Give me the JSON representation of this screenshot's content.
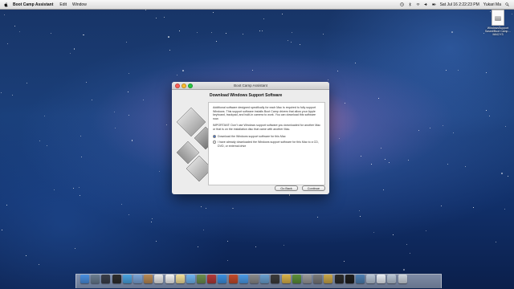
{
  "menubar": {
    "app_name": "Boot Camp Assistant",
    "menus": [
      "Edit",
      "Window"
    ],
    "clock": "Sat Jul 16  2:22:23 PM",
    "user": "Yukari Ma"
  },
  "desktop_icon": {
    "label": "WindowsSupport Saved/Boot Camp… MAC/Y3"
  },
  "window": {
    "title": "Boot Camp Assistant",
    "heading": "Download Windows Support Software",
    "body_p1": "Additional software designed specifically for each Mac is required to fully support Windows. This support software installs Boot Camp drivers that allow your Apple keyboard, trackpad, and built-in camera to work. You can download this software now.",
    "body_p2": "IMPORTANT: Don't use Windows support software you downloaded for another Mac or that is on the installation disc that came with another Mac.",
    "option_download": "Download the Windows support software for this Mac",
    "option_downloaded": "I have already downloaded the Windows support software for this Mac to a CD, DVD, or external drive",
    "selected_option": "download",
    "go_back_label": "Go Back",
    "continue_label": "Continue"
  },
  "dock": {
    "icons": [
      {
        "name": "finder-icon",
        "color": "#4a8fe0"
      },
      {
        "name": "launchpad-icon",
        "color": "#6a7d90"
      },
      {
        "name": "mission-control-icon",
        "color": "#3a3f4a"
      },
      {
        "name": "dashboard-icon",
        "color": "#2e2e2e"
      },
      {
        "name": "safari-icon",
        "color": "#4aa3e0"
      },
      {
        "name": "mail-icon",
        "color": "#7aa5d8"
      },
      {
        "name": "contacts-icon",
        "color": "#b88a56"
      },
      {
        "name": "calendar-icon",
        "color": "#e8e8e8"
      },
      {
        "name": "reminders-icon",
        "color": "#f2f2f2"
      },
      {
        "name": "notes-icon",
        "color": "#f3e09a"
      },
      {
        "name": "messages-icon",
        "color": "#6fb4f0"
      },
      {
        "name": "facetime-icon",
        "color": "#6b8e4e"
      },
      {
        "name": "photo-booth-icon",
        "color": "#b23a3a"
      },
      {
        "name": "itunes-icon",
        "color": "#3b8fe0"
      },
      {
        "name": "books-icon",
        "color": "#c44a2a"
      },
      {
        "name": "app-store-icon",
        "color": "#4b9be8"
      },
      {
        "name": "system-preferences-icon",
        "color": "#8a8a8a"
      },
      {
        "name": "preview-icon",
        "color": "#6aa0d0"
      },
      {
        "name": "console-icon",
        "color": "#3c3c3c"
      },
      {
        "name": "directory-icon",
        "color": "#d9b24a"
      },
      {
        "name": "network-utility-icon",
        "color": "#5c8f3a"
      },
      {
        "name": "disk-utility-icon",
        "color": "#9a9a9a"
      },
      {
        "name": "boot-camp-assistant-icon",
        "color": "#7a7a7a"
      },
      {
        "name": "keychain-icon",
        "color": "#c9a64a"
      },
      {
        "name": "activity-monitor-icon",
        "color": "#2b2b2b"
      },
      {
        "name": "terminal-icon",
        "color": "#1e1e1e"
      },
      {
        "name": "grapher-icon",
        "color": "#4d7fb3"
      },
      {
        "name": "downloads-folder-icon",
        "color": "#b9c6d6"
      },
      {
        "name": "documents-folder-icon",
        "color": "#e9eef5"
      },
      {
        "name": "applications-folder-icon",
        "color": "#b9c6d6"
      },
      {
        "name": "trash-icon",
        "color": "#cfd6df"
      }
    ]
  }
}
